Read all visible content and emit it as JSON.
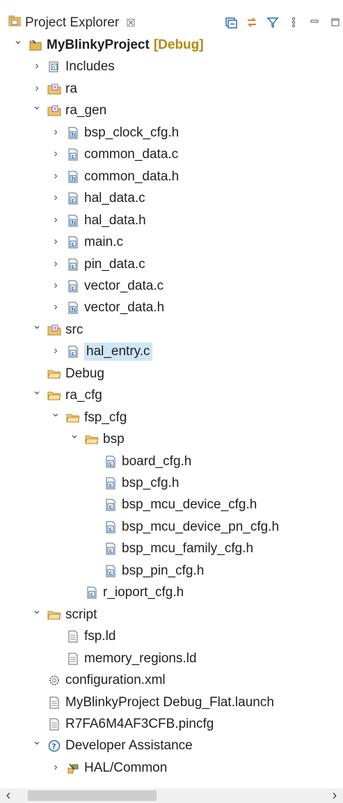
{
  "view": {
    "tab_label": "Project Explorer",
    "tab_close": "☒",
    "toolbar": [
      {
        "name": "collapse-all-icon"
      },
      {
        "name": "link-with-editor-icon"
      },
      {
        "name": "filter-icon"
      },
      {
        "name": "view-menu-icon"
      },
      {
        "name": "minimize-icon"
      },
      {
        "name": "maximize-icon"
      }
    ]
  },
  "tree": [
    {
      "label": "MyBlinkyProject",
      "decor": "[Debug]",
      "bold": true,
      "depth": 0,
      "twisty": "open",
      "icon": "project"
    },
    {
      "label": "Includes",
      "depth": 1,
      "twisty": "closed",
      "icon": "includes"
    },
    {
      "label": "ra",
      "depth": 1,
      "twisty": "closed",
      "icon": "source-folder"
    },
    {
      "label": "ra_gen",
      "depth": 1,
      "twisty": "open",
      "icon": "source-folder"
    },
    {
      "label": "bsp_clock_cfg.h",
      "depth": 2,
      "twisty": "closed",
      "icon": "h-file"
    },
    {
      "label": "common_data.c",
      "depth": 2,
      "twisty": "closed",
      "icon": "c-file"
    },
    {
      "label": "common_data.h",
      "depth": 2,
      "twisty": "closed",
      "icon": "h-file"
    },
    {
      "label": "hal_data.c",
      "depth": 2,
      "twisty": "closed",
      "icon": "c-file"
    },
    {
      "label": "hal_data.h",
      "depth": 2,
      "twisty": "closed",
      "icon": "h-file"
    },
    {
      "label": "main.c",
      "depth": 2,
      "twisty": "closed",
      "icon": "c-file"
    },
    {
      "label": "pin_data.c",
      "depth": 2,
      "twisty": "closed",
      "icon": "c-file"
    },
    {
      "label": "vector_data.c",
      "depth": 2,
      "twisty": "closed",
      "icon": "c-file"
    },
    {
      "label": "vector_data.h",
      "depth": 2,
      "twisty": "closed",
      "icon": "h-file"
    },
    {
      "label": "src",
      "depth": 1,
      "twisty": "open",
      "icon": "source-folder"
    },
    {
      "label": "hal_entry.c",
      "depth": 2,
      "twisty": "closed",
      "icon": "c-file",
      "selected": true
    },
    {
      "label": "Debug",
      "depth": 1,
      "twisty": "none",
      "icon": "folder"
    },
    {
      "label": "ra_cfg",
      "depth": 1,
      "twisty": "open",
      "icon": "folder"
    },
    {
      "label": "fsp_cfg",
      "depth": 2,
      "twisty": "open",
      "icon": "folder"
    },
    {
      "label": "bsp",
      "depth": 3,
      "twisty": "open",
      "icon": "folder"
    },
    {
      "label": "board_cfg.h",
      "depth": 4,
      "twisty": "none",
      "icon": "c-file"
    },
    {
      "label": "bsp_cfg.h",
      "depth": 4,
      "twisty": "none",
      "icon": "c-file"
    },
    {
      "label": "bsp_mcu_device_cfg.h",
      "depth": 4,
      "twisty": "none",
      "icon": "c-file"
    },
    {
      "label": "bsp_mcu_device_pn_cfg.h",
      "depth": 4,
      "twisty": "none",
      "icon": "c-file"
    },
    {
      "label": "bsp_mcu_family_cfg.h",
      "depth": 4,
      "twisty": "none",
      "icon": "c-file"
    },
    {
      "label": "bsp_pin_cfg.h",
      "depth": 4,
      "twisty": "none",
      "icon": "c-file"
    },
    {
      "label": "r_ioport_cfg.h",
      "depth": 3,
      "twisty": "none",
      "icon": "c-file"
    },
    {
      "label": "script",
      "depth": 1,
      "twisty": "open",
      "icon": "folder"
    },
    {
      "label": "fsp.ld",
      "depth": 2,
      "twisty": "none",
      "icon": "text-file"
    },
    {
      "label": "memory_regions.ld",
      "depth": 2,
      "twisty": "none",
      "icon": "text-file"
    },
    {
      "label": "configuration.xml",
      "depth": 1,
      "twisty": "none",
      "icon": "config-file"
    },
    {
      "label": "MyBlinkyProject Debug_Flat.launch",
      "depth": 1,
      "twisty": "none",
      "icon": "text-file"
    },
    {
      "label": "R7FA6M4AF3CFB.pincfg",
      "depth": 1,
      "twisty": "none",
      "icon": "text-file"
    },
    {
      "label": "Developer Assistance",
      "depth": 1,
      "twisty": "open",
      "icon": "help"
    },
    {
      "label": "HAL/Common",
      "depth": 2,
      "twisty": "closed",
      "icon": "hal"
    }
  ],
  "scrollbar": {
    "left_arrow": "‹",
    "right_arrow": "›"
  }
}
